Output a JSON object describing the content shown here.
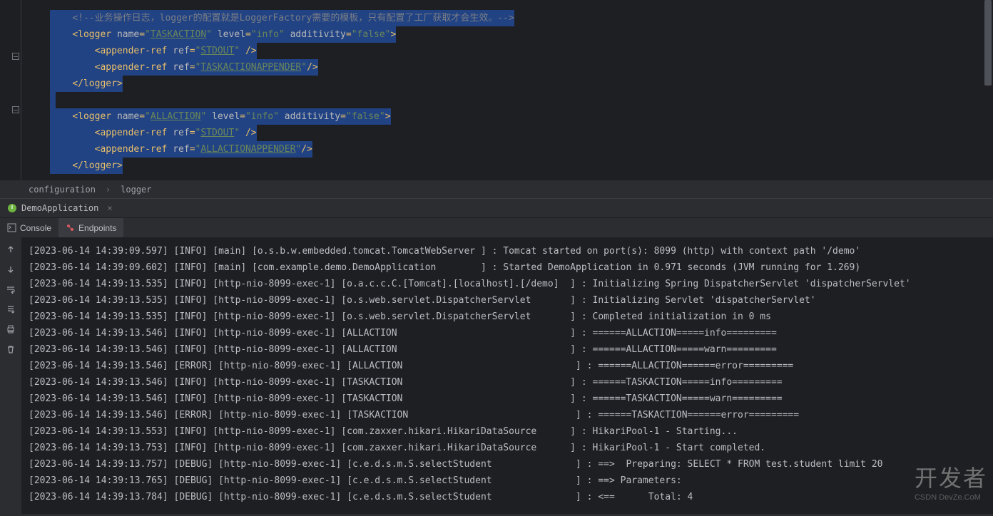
{
  "editor": {
    "lines": [
      {
        "segments": [
          {
            "t": "    ",
            "cls": ""
          },
          {
            "t": "<!--业务操作日志，logger的配置就是LoggerFactory需要的模板，只有配置了工厂获取才会生效。-->",
            "cls": "cmt"
          }
        ]
      },
      {
        "segments": [
          {
            "t": "    ",
            "cls": ""
          },
          {
            "t": "<logger ",
            "cls": "tag"
          },
          {
            "t": "name",
            "cls": "attr"
          },
          {
            "t": "=",
            "cls": "tag"
          },
          {
            "t": "\"",
            "cls": "str"
          },
          {
            "t": "TASKACTION",
            "cls": "strunder"
          },
          {
            "t": "\" ",
            "cls": "str"
          },
          {
            "t": "level",
            "cls": "attr"
          },
          {
            "t": "=",
            "cls": "tag"
          },
          {
            "t": "\"info\" ",
            "cls": "str"
          },
          {
            "t": "additivity",
            "cls": "attr"
          },
          {
            "t": "=",
            "cls": "tag"
          },
          {
            "t": "\"false\"",
            "cls": "str"
          },
          {
            "t": ">",
            "cls": "tag"
          }
        ]
      },
      {
        "segments": [
          {
            "t": "        ",
            "cls": ""
          },
          {
            "t": "<appender-ref ",
            "cls": "tag"
          },
          {
            "t": "ref",
            "cls": "attr"
          },
          {
            "t": "=",
            "cls": "tag"
          },
          {
            "t": "\"",
            "cls": "str"
          },
          {
            "t": "STDOUT",
            "cls": "strunder"
          },
          {
            "t": "\" ",
            "cls": "str"
          },
          {
            "t": "/>",
            "cls": "tag"
          }
        ]
      },
      {
        "segments": [
          {
            "t": "        ",
            "cls": ""
          },
          {
            "t": "<appender-ref ",
            "cls": "tag"
          },
          {
            "t": "ref",
            "cls": "attr"
          },
          {
            "t": "=",
            "cls": "tag"
          },
          {
            "t": "\"",
            "cls": "str"
          },
          {
            "t": "TASKACTIONAPPENDER",
            "cls": "strunder"
          },
          {
            "t": "\"",
            "cls": "str"
          },
          {
            "t": "/>",
            "cls": "tag"
          }
        ]
      },
      {
        "segments": [
          {
            "t": "    ",
            "cls": ""
          },
          {
            "t": "</logger>",
            "cls": "tag"
          }
        ]
      },
      {
        "segments": [
          {
            "t": " ",
            "cls": ""
          }
        ]
      },
      {
        "segments": [
          {
            "t": "    ",
            "cls": ""
          },
          {
            "t": "<logger ",
            "cls": "tag"
          },
          {
            "t": "name",
            "cls": "attr"
          },
          {
            "t": "=",
            "cls": "tag"
          },
          {
            "t": "\"",
            "cls": "str"
          },
          {
            "t": "ALLACTION",
            "cls": "strunder"
          },
          {
            "t": "\" ",
            "cls": "str"
          },
          {
            "t": "level",
            "cls": "attr"
          },
          {
            "t": "=",
            "cls": "tag"
          },
          {
            "t": "\"info\" ",
            "cls": "str"
          },
          {
            "t": "additivity",
            "cls": "attr"
          },
          {
            "t": "=",
            "cls": "tag"
          },
          {
            "t": "\"false\"",
            "cls": "str"
          },
          {
            "t": ">",
            "cls": "tag"
          }
        ]
      },
      {
        "segments": [
          {
            "t": "        ",
            "cls": ""
          },
          {
            "t": "<appender-ref ",
            "cls": "tag"
          },
          {
            "t": "ref",
            "cls": "attr"
          },
          {
            "t": "=",
            "cls": "tag"
          },
          {
            "t": "\"",
            "cls": "str"
          },
          {
            "t": "STDOUT",
            "cls": "strunder"
          },
          {
            "t": "\" ",
            "cls": "str"
          },
          {
            "t": "/>",
            "cls": "tag"
          }
        ]
      },
      {
        "segments": [
          {
            "t": "        ",
            "cls": ""
          },
          {
            "t": "<appender-ref ",
            "cls": "tag"
          },
          {
            "t": "ref",
            "cls": "attr"
          },
          {
            "t": "=",
            "cls": "tag"
          },
          {
            "t": "\"",
            "cls": "str"
          },
          {
            "t": "ALLACTIONAPPENDER",
            "cls": "strunder"
          },
          {
            "t": "\"",
            "cls": "str"
          },
          {
            "t": "/>",
            "cls": "tag"
          }
        ]
      },
      {
        "segments": [
          {
            "t": "    ",
            "cls": ""
          },
          {
            "t": "</logger>",
            "cls": "tag"
          }
        ]
      }
    ]
  },
  "breadcrumb": {
    "item1": "configuration",
    "item2": "logger"
  },
  "runTab": {
    "label": "DemoApplication"
  },
  "panelTabs": {
    "console": "Console",
    "endpoints": "Endpoints"
  },
  "console": {
    "lines": [
      "[2023-06-14 14:39:09.597] [INFO] [main] [o.s.b.w.embedded.tomcat.TomcatWebServer ] : Tomcat started on port(s): 8099 (http) with context path '/demo'",
      "[2023-06-14 14:39:09.602] [INFO] [main] [com.example.demo.DemoApplication        ] : Started DemoApplication in 0.971 seconds (JVM running for 1.269)",
      "[2023-06-14 14:39:13.535] [INFO] [http-nio-8099-exec-1] [o.a.c.c.C.[Tomcat].[localhost].[/demo]  ] : Initializing Spring DispatcherServlet 'dispatcherServlet'",
      "[2023-06-14 14:39:13.535] [INFO] [http-nio-8099-exec-1] [o.s.web.servlet.DispatcherServlet       ] : Initializing Servlet 'dispatcherServlet'",
      "[2023-06-14 14:39:13.535] [INFO] [http-nio-8099-exec-1] [o.s.web.servlet.DispatcherServlet       ] : Completed initialization in 0 ms",
      "[2023-06-14 14:39:13.546] [INFO] [http-nio-8099-exec-1] [ALLACTION                               ] : ======ALLACTION=====info=========",
      "[2023-06-14 14:39:13.546] [INFO] [http-nio-8099-exec-1] [ALLACTION                               ] : ======ALLACTION=====warn=========",
      "[2023-06-14 14:39:13.546] [ERROR] [http-nio-8099-exec-1] [ALLACTION                               ] : ======ALLACTION======error=========",
      "[2023-06-14 14:39:13.546] [INFO] [http-nio-8099-exec-1] [TASKACTION                              ] : ======TASKACTION=====info=========",
      "[2023-06-14 14:39:13.546] [INFO] [http-nio-8099-exec-1] [TASKACTION                              ] : ======TASKACTION=====warn=========",
      "[2023-06-14 14:39:13.546] [ERROR] [http-nio-8099-exec-1] [TASKACTION                              ] : ======TASKACTION======error=========",
      "[2023-06-14 14:39:13.553] [INFO] [http-nio-8099-exec-1] [com.zaxxer.hikari.HikariDataSource      ] : HikariPool-1 - Starting...",
      "[2023-06-14 14:39:13.753] [INFO] [http-nio-8099-exec-1] [com.zaxxer.hikari.HikariDataSource      ] : HikariPool-1 - Start completed.",
      "[2023-06-14 14:39:13.757] [DEBUG] [http-nio-8099-exec-1] [c.e.d.s.m.S.selectStudent               ] : ==>  Preparing: SELECT * FROM test.student limit 20",
      "[2023-06-14 14:39:13.765] [DEBUG] [http-nio-8099-exec-1] [c.e.d.s.m.S.selectStudent               ] : ==> Parameters:",
      "[2023-06-14 14:39:13.784] [DEBUG] [http-nio-8099-exec-1] [c.e.d.s.m.S.selectStudent               ] : <==      Total: 4"
    ]
  },
  "watermark": {
    "line1": "开发者",
    "line2": "CSDN DevZe.CoM"
  }
}
